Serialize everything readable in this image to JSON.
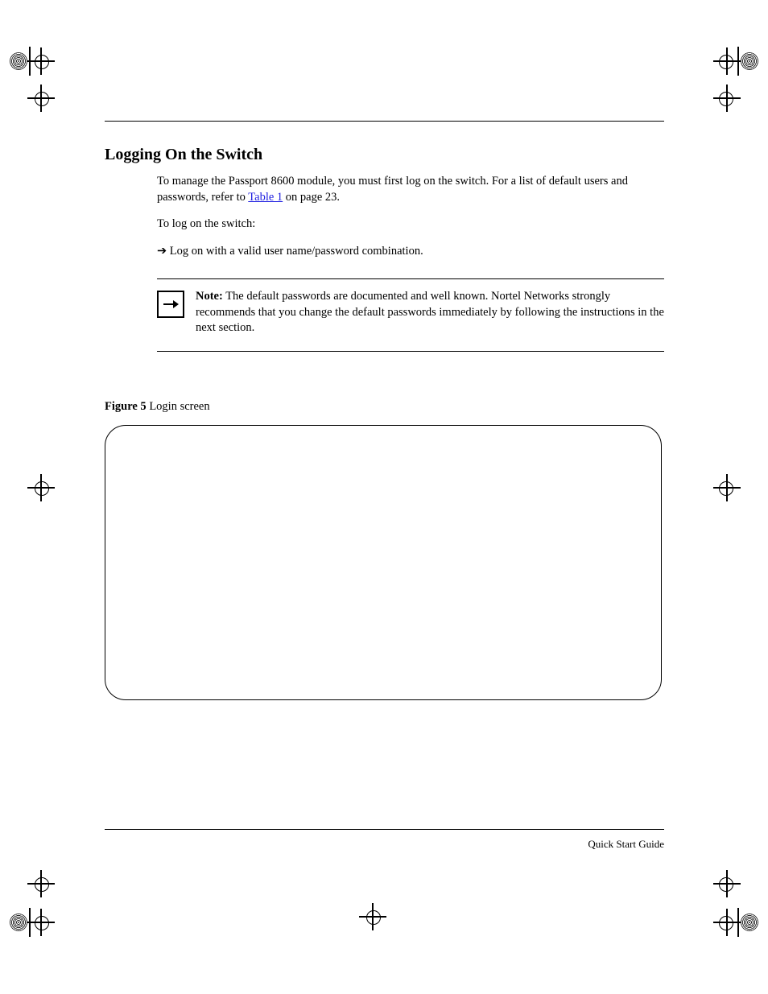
{
  "section_heading": "Logging On the Switch",
  "intro": {
    "p1_prefix": "To manage the Passport 8600 module, you must first log on the switch. For a list of default users and passwords, refer to ",
    "p1_link_text": "Table 1",
    "p1_link_suffix": " on page 23.",
    "p2": "To log on the switch:"
  },
  "step": {
    "prefix": "➔",
    "text": "Log on with a valid user name/password combination."
  },
  "note": {
    "label": "Note:",
    "text": " The default passwords are documented and well known. Nortel Networks strongly recommends that you change the default passwords immediately by following the instructions in the next section."
  },
  "figure": {
    "label": "Figure 5",
    "caption": "   Login screen"
  },
  "footer_text": "Quick Start Guide"
}
